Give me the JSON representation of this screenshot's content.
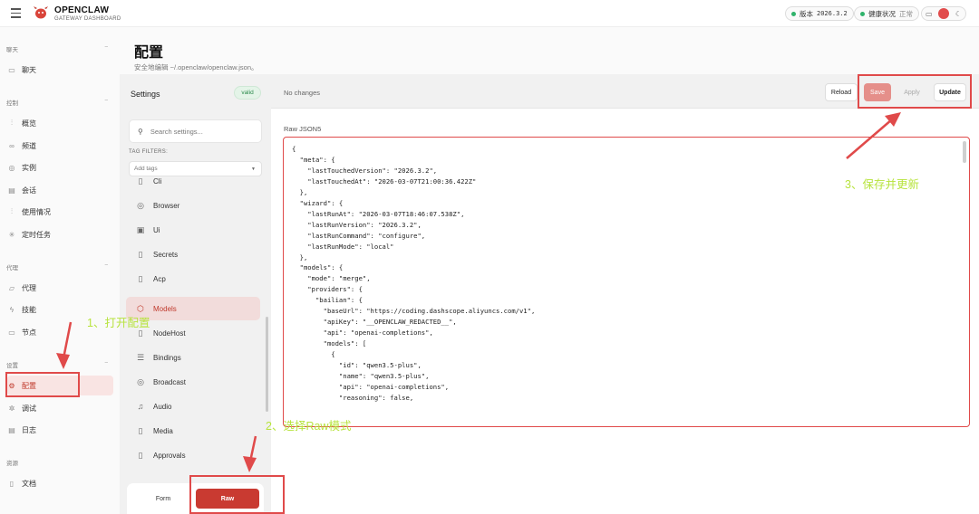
{
  "app": {
    "brand_title": "OPENCLAW",
    "brand_subtitle": "GATEWAY DASHBOARD"
  },
  "topbar": {
    "version_label": "版本",
    "version_value": "2026.3.2",
    "health_label": "健康状况",
    "health_value": "正常"
  },
  "sidebar": {
    "sections": [
      {
        "title": "聊天",
        "items": [
          {
            "label": "聊天",
            "icon": "chat-bubble-icon"
          }
        ]
      },
      {
        "title": "控制",
        "items": [
          {
            "label": "概览",
            "icon": "bar-chart-icon"
          },
          {
            "label": "频道",
            "icon": "link-icon"
          },
          {
            "label": "实例",
            "icon": "radio-icon"
          },
          {
            "label": "会话",
            "icon": "document-icon"
          },
          {
            "label": "使用情况",
            "icon": "bar-chart-icon"
          },
          {
            "label": "定时任务",
            "icon": "loader-icon"
          }
        ]
      },
      {
        "title": "代理",
        "items": [
          {
            "label": "代理",
            "icon": "folder-icon"
          },
          {
            "label": "技能",
            "icon": "bolt-icon"
          },
          {
            "label": "节点",
            "icon": "monitor-icon"
          }
        ]
      },
      {
        "title": "设置",
        "items": [
          {
            "label": "配置",
            "icon": "gear-icon",
            "active": true
          },
          {
            "label": "调试",
            "icon": "bug-icon"
          },
          {
            "label": "日志",
            "icon": "log-icon"
          }
        ]
      },
      {
        "title": "资源",
        "items": [
          {
            "label": "文档",
            "icon": "book-icon"
          }
        ]
      }
    ]
  },
  "page": {
    "title": "配置",
    "subtitle": "安全地编辑 ~/.openclaw/openclaw.json。"
  },
  "settings_panel": {
    "heading": "Settings",
    "status_badge": "valid",
    "search_placeholder": "Search settings...",
    "tag_filters_label": "TAG FILTERS:",
    "tag_select_placeholder": "Add tags",
    "categories": [
      {
        "label": "Cli",
        "icon": "document-icon"
      },
      {
        "label": "Browser",
        "icon": "compass-icon"
      },
      {
        "label": "Ui",
        "icon": "layout-icon"
      },
      {
        "label": "Secrets",
        "icon": "document-icon"
      },
      {
        "label": "Acp",
        "icon": "document-icon"
      },
      {
        "label": "Models",
        "icon": "cube-icon",
        "active": true
      },
      {
        "label": "NodeHost",
        "icon": "document-icon"
      },
      {
        "label": "Bindings",
        "icon": "stack-icon"
      },
      {
        "label": "Broadcast",
        "icon": "radio-icon"
      },
      {
        "label": "Audio",
        "icon": "music-icon"
      },
      {
        "label": "Media",
        "icon": "document-icon"
      },
      {
        "label": "Approvals",
        "icon": "document-icon"
      }
    ],
    "mode_form": "Form",
    "mode_raw": "Raw"
  },
  "editor": {
    "status": "No changes",
    "reload_label": "Reload",
    "save_label": "Save",
    "apply_label": "Apply",
    "update_label": "Update",
    "raw_label": "Raw JSON5",
    "content": "{\n  \"meta\": {\n    \"lastTouchedVersion\": \"2026.3.2\",\n    \"lastTouchedAt\": \"2026-03-07T21:00:36.422Z\"\n  },\n  \"wizard\": {\n    \"lastRunAt\": \"2026-03-07T18:46:07.538Z\",\n    \"lastRunVersion\": \"2026.3.2\",\n    \"lastRunCommand\": \"configure\",\n    \"lastRunMode\": \"local\"\n  },\n  \"models\": {\n    \"mode\": \"merge\",\n    \"providers\": {\n      \"bailian\": {\n        \"baseUrl\": \"https://coding.dashscope.aliyuncs.com/v1\",\n        \"apiKey\": \"__OPENCLAW_REDACTED__\",\n        \"api\": \"openai-completions\",\n        \"models\": [\n          {\n            \"id\": \"qwen3.5-plus\",\n            \"name\": \"qwen3.5-plus\",\n            \"api\": \"openai-completions\",\n            \"reasoning\": false,"
  },
  "annotations": {
    "step1": "1、打开配置",
    "step2": "2、选择Raw模式",
    "step3": "3、保存并更新",
    "color": "#b7e33c",
    "highlight_color": "#e04a4a"
  }
}
